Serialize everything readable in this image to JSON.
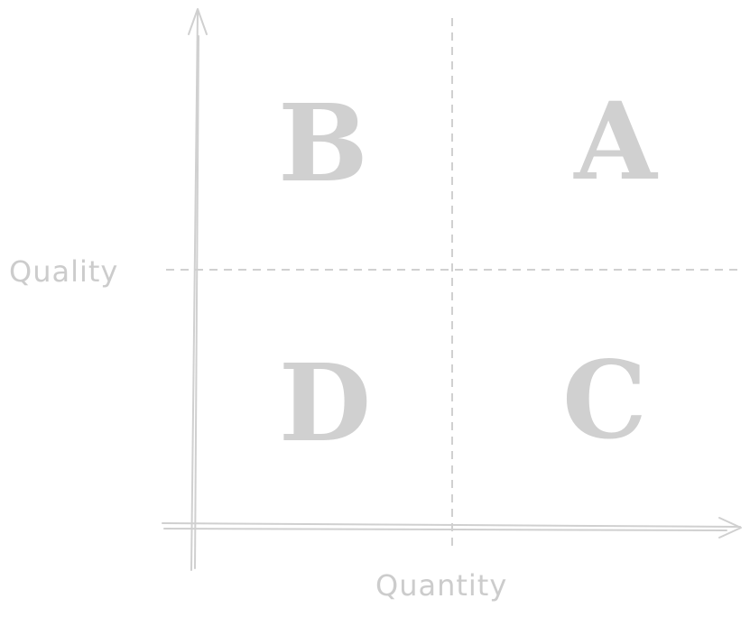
{
  "axes": {
    "x_label": "Quantity",
    "y_label": "Quality"
  },
  "quadrants": {
    "top_left": "B",
    "top_right": "A",
    "bottom_left": "D",
    "bottom_right": "C"
  },
  "colors": {
    "stroke": "#d0d0d0",
    "text": "#cccccc",
    "background": "#ffffff"
  }
}
